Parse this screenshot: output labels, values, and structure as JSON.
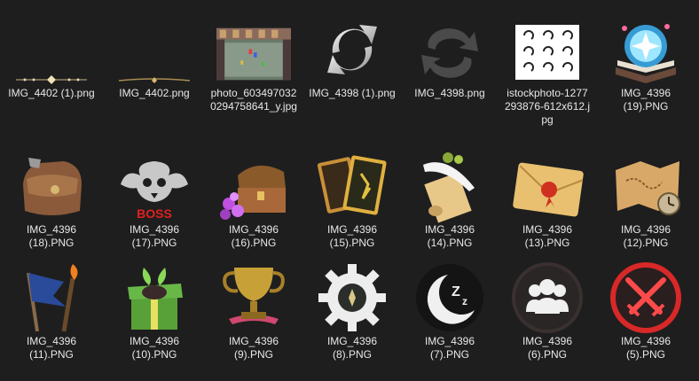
{
  "files": [
    {
      "name": "IMG_4402 (1).png",
      "icon": "dotted-divider-line-icon"
    },
    {
      "name": "IMG_4402.png",
      "icon": "gold-divider-line-icon"
    },
    {
      "name": "photo_6034970320294758641_y.jpg",
      "icon": "pixel-game-screenshot-icon"
    },
    {
      "name": "IMG_4398 (1).png",
      "icon": "refresh-arrows-silver-icon"
    },
    {
      "name": "IMG_4398.png",
      "icon": "refresh-arrows-gray-icon"
    },
    {
      "name": "istockphoto-1277293876-612x612.jpg",
      "icon": "refresh-arrows-grid-icon"
    },
    {
      "name": "IMG_4396 (19).PNG",
      "icon": "magic-book-icon"
    },
    {
      "name": "IMG_4396 (18).PNG",
      "icon": "leather-bag-icon"
    },
    {
      "name": "IMG_4396 (17).PNG",
      "icon": "boss-skull-icon"
    },
    {
      "name": "IMG_4396 (16).PNG",
      "icon": "treasure-chest-icon"
    },
    {
      "name": "IMG_4396 (15).PNG",
      "icon": "cards-icon"
    },
    {
      "name": "IMG_4396 (14).PNG",
      "icon": "scroll-quill-icon"
    },
    {
      "name": "IMG_4396 (13).PNG",
      "icon": "sealed-envelope-icon"
    },
    {
      "name": "IMG_4396 (12).PNG",
      "icon": "treasure-map-icon"
    },
    {
      "name": "IMG_4396 (11).PNG",
      "icon": "flag-torch-icon"
    },
    {
      "name": "IMG_4396 (10).PNG",
      "icon": "gift-box-icon"
    },
    {
      "name": "IMG_4396 (9).PNG",
      "icon": "trophy-icon"
    },
    {
      "name": "IMG_4396 (8).PNG",
      "icon": "gear-icon"
    },
    {
      "name": "IMG_4396 (7).PNG",
      "icon": "moon-sleep-icon"
    },
    {
      "name": "IMG_4396 (6).PNG",
      "icon": "group-users-icon"
    },
    {
      "name": "IMG_4396 (5).PNG",
      "icon": "crossed-swords-icon"
    }
  ],
  "labels_display": [
    "IMG_4402 (1).png",
    "IMG_4402.png",
    "photo_603497032\n0294758641_y.jpg",
    "IMG_4398 (1).png",
    "IMG_4398.png",
    "istockphoto-1277\n293876-612x612.j\npg",
    "IMG_4396\n(19).PNG",
    "IMG_4396\n(18).PNG",
    "IMG_4396\n(17).PNG",
    "IMG_4396\n(16).PNG",
    "IMG_4396\n(15).PNG",
    "IMG_4396\n(14).PNG",
    "IMG_4396\n(13).PNG",
    "IMG_4396\n(12).PNG",
    "IMG_4396\n(11).PNG",
    "IMG_4396\n(10).PNG",
    "IMG_4396\n(9).PNG",
    "IMG_4396\n(8).PNG",
    "IMG_4396\n(7).PNG",
    "IMG_4396\n(6).PNG",
    "IMG_4396\n(5).PNG"
  ]
}
